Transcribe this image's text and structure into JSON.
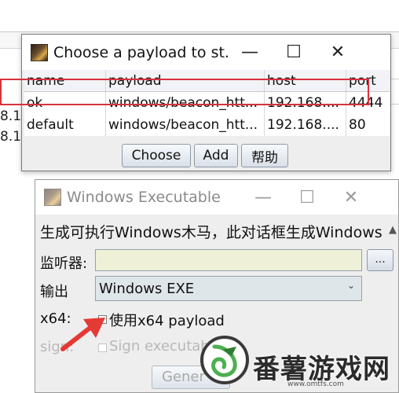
{
  "background": {
    "edge_texts": [
      "8.1",
      "8.1"
    ]
  },
  "payload_dialog": {
    "title": "Choose a payload to st...",
    "window_buttons": {
      "minimize": "—",
      "maximize": "☐",
      "close": "✕"
    },
    "columns": [
      "name",
      "payload",
      "host",
      "port"
    ],
    "rows": [
      {
        "name": "ok",
        "payload": "windows/beacon_htt...",
        "host": "192.168....",
        "port": "4444"
      },
      {
        "name": "default",
        "payload": "windows/beacon_htt...",
        "host": "192.168....",
        "port": "80"
      }
    ],
    "buttons": {
      "choose": "Choose",
      "add": "Add",
      "help": "帮助"
    },
    "highlight_color": "#d8323c"
  },
  "exe_dialog": {
    "title": "Windows Executable",
    "window_buttons": {
      "minimize": "—",
      "maximize": "☐",
      "close": "✕"
    },
    "description": "生成可执行Windows木马，此对话框生成Windows",
    "listener_label": "监听器:",
    "listener_value": "",
    "browse_label": "...",
    "output_label": "输出",
    "output_value": "Windows EXE",
    "x64_label": "x64:",
    "x64_checkbox_label": "使用x64 payload",
    "sign_label": "sign:",
    "sign_checkbox_label": "Sign executab",
    "generate_label": "Gener"
  },
  "watermark": {
    "text": "番薯游戏网",
    "url": "www.omtfs.com"
  }
}
